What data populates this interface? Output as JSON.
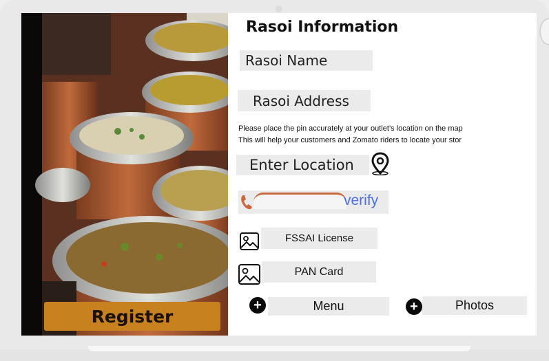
{
  "form": {
    "title": "Rasoi Information",
    "rasoi_name_placeholder": "Rasoi Name",
    "rasoi_address_placeholder": "Rasoi Address",
    "hint_line1": "Please place the pin accurately at your outlet’s location on the map",
    "hint_line2": "This will help your customers and Zomato riders to locate your stor",
    "location_placeholder": "Enter Location",
    "verify_label": "verify",
    "fssai_label": "FSSAI License",
    "pan_label": "PAN Card",
    "menu_label": "Menu",
    "photos_label": "Photos"
  },
  "register_label": "Register",
  "icons": {
    "location": "map-pin-icon",
    "phone": "phone-icon",
    "image": "image-icon",
    "add": "plus-circle-icon"
  },
  "colors": {
    "register_bg": "#c7811f",
    "verify_text": "#4a6fe0",
    "phone_accent": "#c8683c",
    "field_bg": "#ebebeb"
  }
}
